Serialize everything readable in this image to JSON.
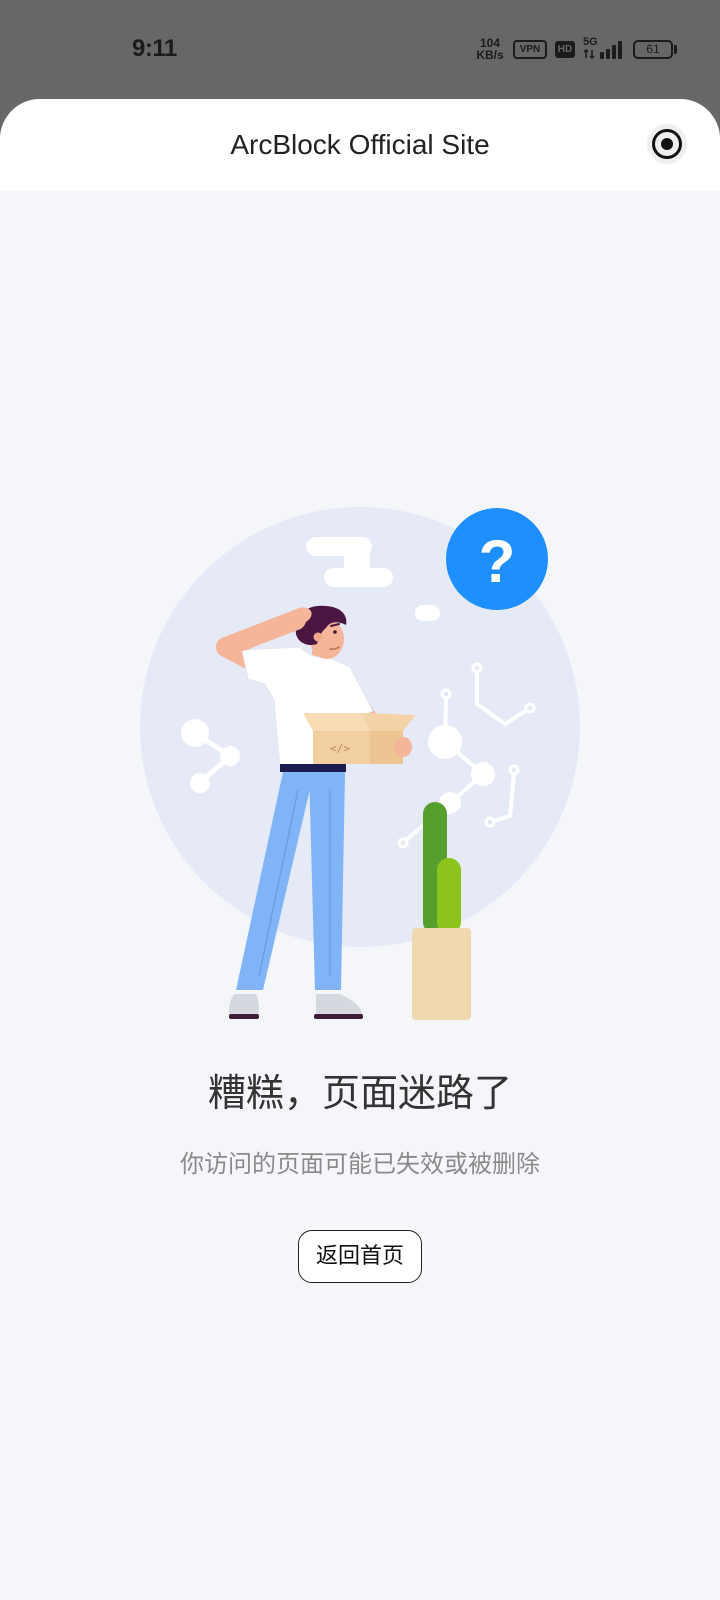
{
  "status_bar": {
    "time": "9:11",
    "net_speed": {
      "value": "104",
      "unit": "KB/s"
    },
    "vpn_badge": "VPN",
    "hd_badge": "HD",
    "network_type": "5G",
    "battery_percent": "61",
    "icons": {
      "data_activity": "data-arrows-icon",
      "signal": "cellular-signal-icon",
      "battery": "battery-icon"
    }
  },
  "header": {
    "title": "ArcBlock Official Site",
    "action_icon": "target-circle-icon"
  },
  "illustration": {
    "icon": "lost-package-illustration",
    "question_mark": "?",
    "box_glyph": "</>"
  },
  "error": {
    "heading": "糟糕，页面迷路了",
    "message": "你访问的页面可能已失效或被删除",
    "home_button": "返回首页"
  },
  "colors": {
    "status_overlay": "#676767",
    "page_background": "#f5f6fa",
    "header_background": "#ffffff",
    "accent_blue": "#1e8fff",
    "heading_text": "#333333",
    "message_text": "#8a8a8a"
  }
}
